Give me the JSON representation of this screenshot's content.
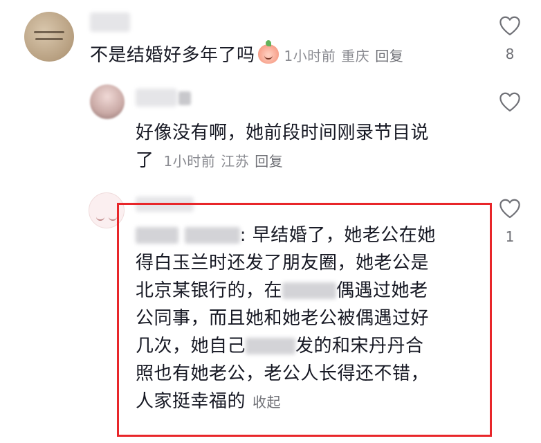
{
  "comments": [
    {
      "text": "不是结婚好多年了吗",
      "emoji": "peach-emoji",
      "time": "1小时前",
      "location": "重庆",
      "reply_label": "回复",
      "likes": "8"
    },
    {
      "text_line1": "好像没有啊，她前段时间刚录节目说",
      "text_line2": "了",
      "time": "1小时前",
      "location": "江苏",
      "reply_label": "回复"
    },
    {
      "prefix_visible": ": 早结婚了，她老公在她",
      "line2": "得白玉兰时还发了朋友圈，她老公是",
      "line3a": "北京某银行的，在",
      "line3b": "偶遇过她老",
      "line4": "公同事，而且她和她老公被偶遇过好",
      "line5a": "几次，她自己",
      "line5b": "发的和宋丹丹合",
      "line6": "照也有她老公，老公人长得还不错，",
      "line7": "人家挺幸福的",
      "collapse_label": "收起",
      "likes": "1"
    }
  ],
  "colors": {
    "highlight_border": "#e8262a",
    "meta_text": "#8a8b91",
    "body_text": "#161823"
  },
  "icons": [
    "heart-outline-icon",
    "peach-emoji"
  ]
}
